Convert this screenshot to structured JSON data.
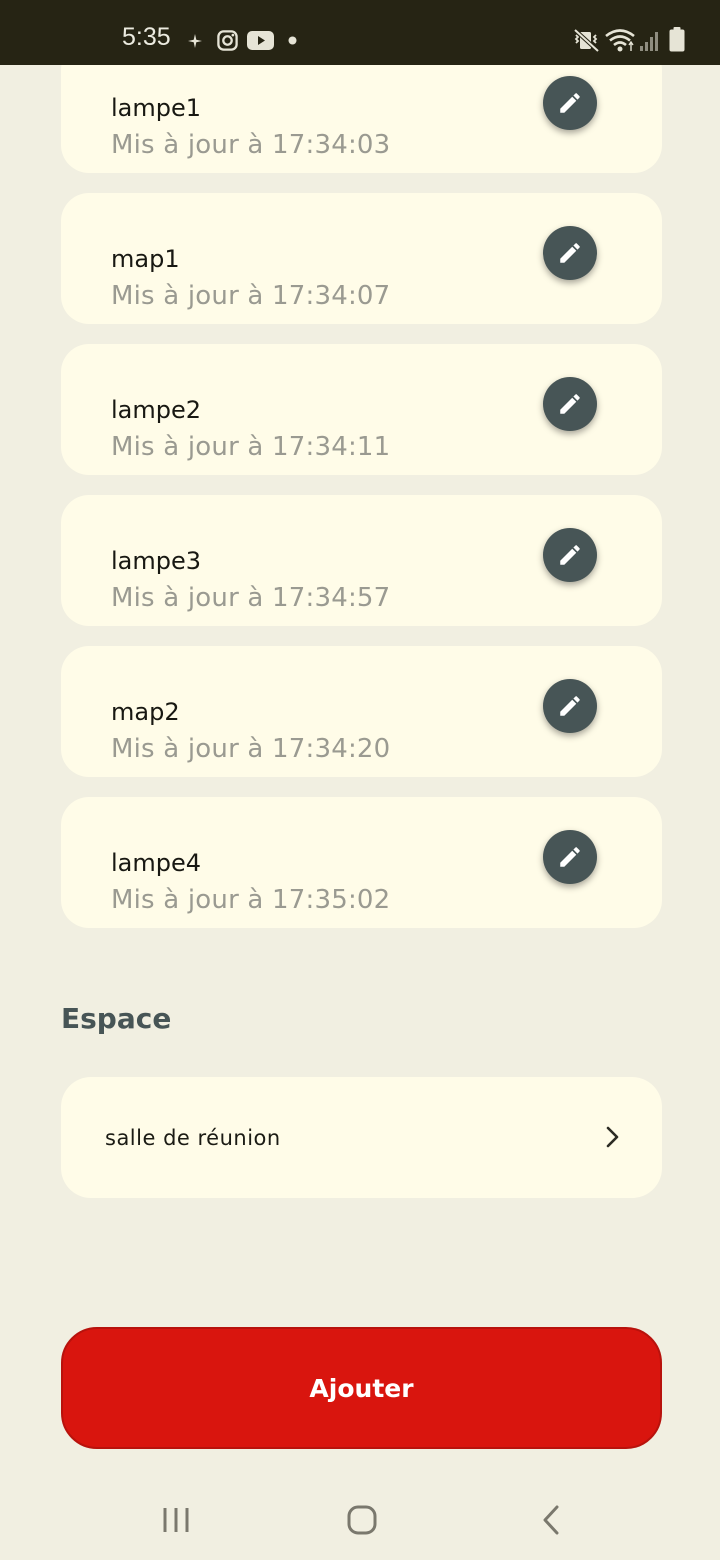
{
  "status_bar": {
    "time": "5:35",
    "left_icons": [
      "sparkle-icon",
      "instagram-icon",
      "youtube-icon",
      "dot-icon"
    ],
    "right_icons": [
      "vibrate-mute-icon",
      "wifi-icon",
      "signal-icon",
      "battery-icon"
    ]
  },
  "devices": [
    {
      "name": "lampe1",
      "updated": "Mis à jour à 17:34:03"
    },
    {
      "name": "map1",
      "updated": "Mis à jour à 17:34:07"
    },
    {
      "name": "lampe2",
      "updated": "Mis à jour à 17:34:11"
    },
    {
      "name": "lampe3",
      "updated": "Mis à jour à 17:34:57"
    },
    {
      "name": "map2",
      "updated": "Mis à jour à 17:34:20"
    },
    {
      "name": "lampe4",
      "updated": "Mis à jour à 17:35:02"
    }
  ],
  "space_section": {
    "title": "Espace",
    "item": "salle de réunion"
  },
  "actions": {
    "add_label": "Ajouter"
  },
  "colors": {
    "background": "#f1efe1",
    "card": "#fffce8",
    "accent_red": "#d9150e",
    "edit_button": "#475556",
    "status_bar": "#262414"
  }
}
